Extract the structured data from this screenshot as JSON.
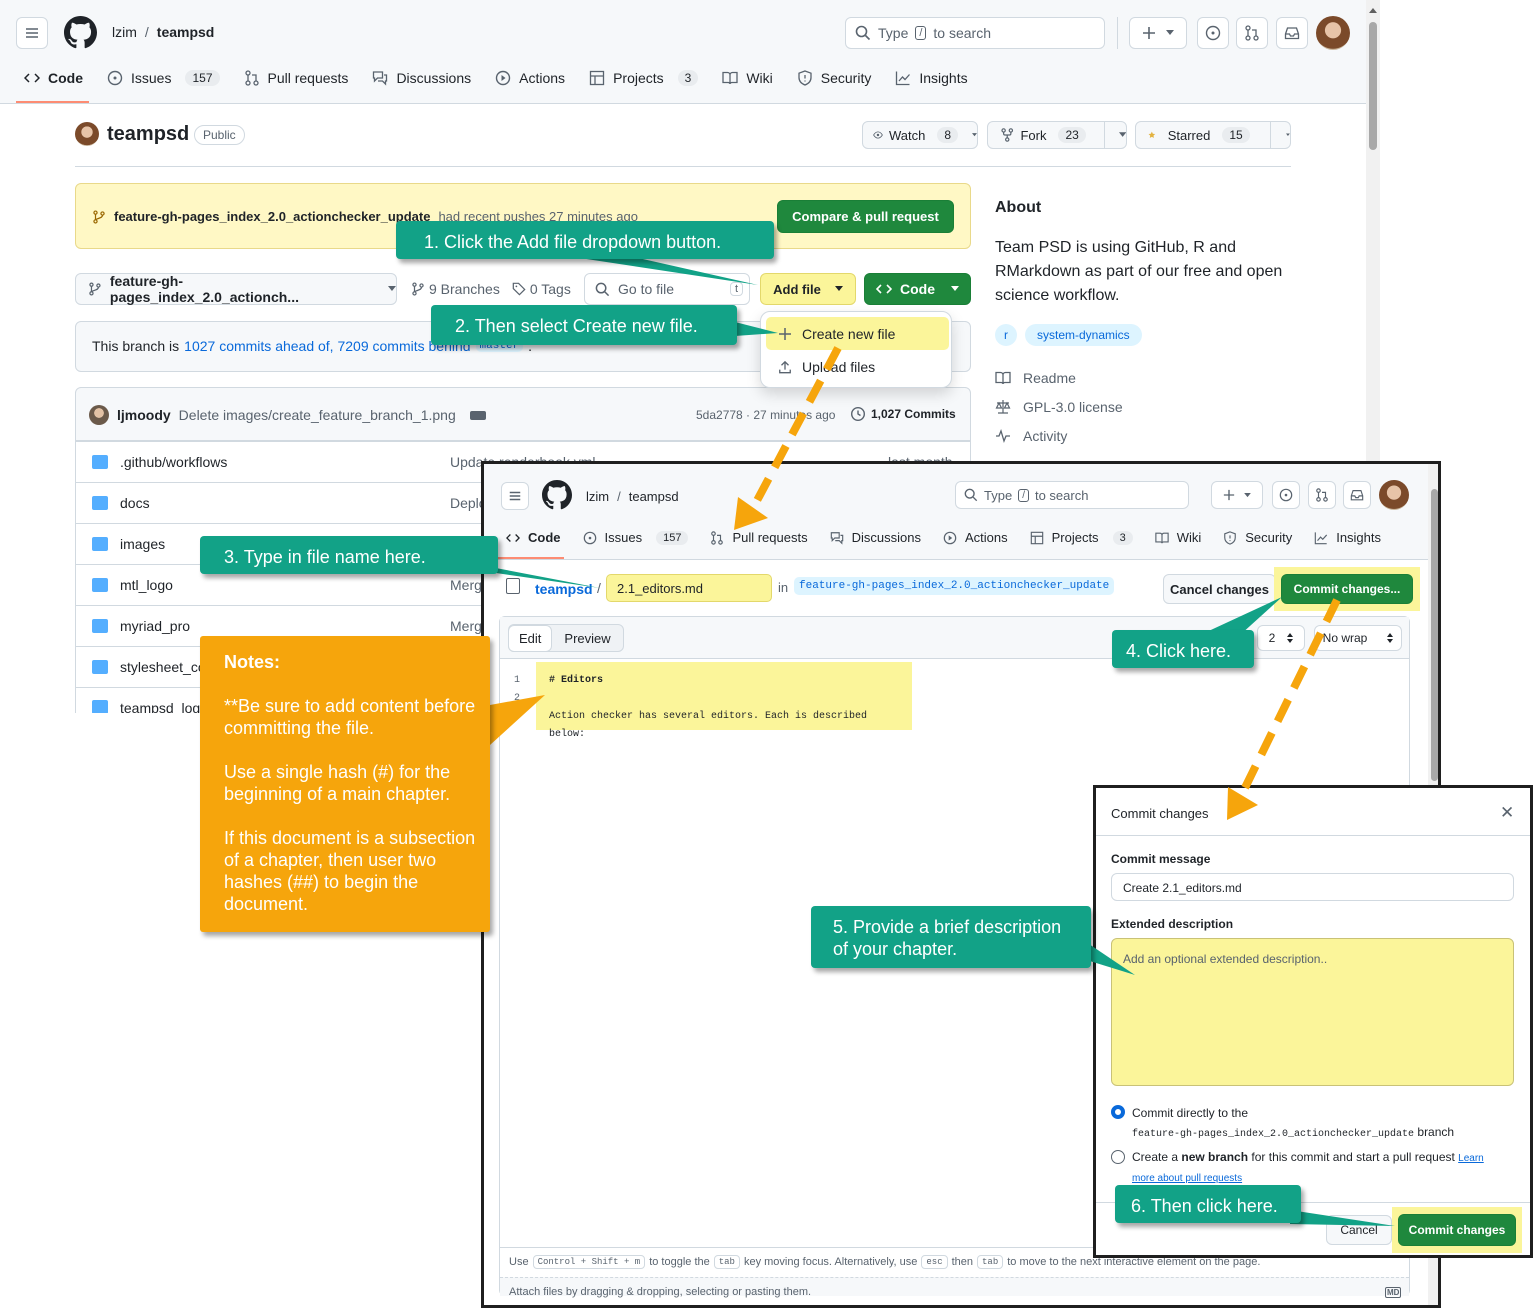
{
  "top": {
    "owner": "lzim",
    "repo": "teampsd",
    "search_prefix": "Type",
    "search_key": "/",
    "search_suffix": "to search"
  },
  "tabs": [
    {
      "label": "Code",
      "count": ""
    },
    {
      "label": "Issues",
      "count": "157"
    },
    {
      "label": "Pull requests",
      "count": ""
    },
    {
      "label": "Discussions",
      "count": ""
    },
    {
      "label": "Actions",
      "count": ""
    },
    {
      "label": "Projects",
      "count": "3"
    },
    {
      "label": "Wiki",
      "count": ""
    },
    {
      "label": "Security",
      "count": ""
    },
    {
      "label": "Insights",
      "count": ""
    }
  ],
  "repo_header": {
    "name": "teampsd",
    "visibility": "Public",
    "watch_label": "Watch",
    "watch_count": "8",
    "fork_label": "Fork",
    "fork_count": "23",
    "star_label": "Starred",
    "star_count": "15"
  },
  "banner": {
    "branch": "feature-gh-pages_index_2.0_actionchecker_update",
    "text": "had recent pushes 27 minutes ago",
    "button": "Compare & pull request"
  },
  "toolbar": {
    "branch": "feature-gh-pages_index_2.0_actionch...",
    "branches": "9 Branches",
    "tags": "0 Tags",
    "goto_placeholder": "Go to file",
    "goto_key": "t",
    "add_file": "Add file",
    "code": "Code"
  },
  "dropdown": {
    "create": "Create new file",
    "upload": "Upload files"
  },
  "ahead": {
    "prefix": "This branch is",
    "link": "1027 commits ahead of, 7209 commits behind",
    "base": "master",
    "suffix": "."
  },
  "commit": {
    "author": "ljmoody",
    "message": "Delete images/create_feature_branch_1.png",
    "meta": "5da2778 · 27 minutes ago",
    "count": "1,027 Commits"
  },
  "files": [
    {
      "name": ".github/workflows",
      "msg": "Update renderbook.yml",
      "time": "last month"
    },
    {
      "name": "docs",
      "msg": "Deplo",
      "time": ""
    },
    {
      "name": "images",
      "msg": "",
      "time": ""
    },
    {
      "name": "mtl_logo",
      "msg": "Merg",
      "time": ""
    },
    {
      "name": "myriad_pro",
      "msg": "Merg",
      "time": ""
    },
    {
      "name": "stylesheet_co",
      "msg": "",
      "time": ""
    },
    {
      "name": "teampsd_logo",
      "msg": "",
      "time": ""
    }
  ],
  "about": {
    "title": "About",
    "description": "Team PSD is using GitHub, R and RMarkdown as part of our free and open science workflow.",
    "topics": [
      "r",
      "system-dynamics"
    ],
    "links": [
      "Readme",
      "GPL-3.0 license",
      "Activity"
    ]
  },
  "editor": {
    "repo_link": "teampsd",
    "filename": "2.1_editors.md",
    "in": "in",
    "branch": "feature-gh-pages_index_2.0_actionchecker_update",
    "cancel": "Cancel changes",
    "commit": "Commit changes...",
    "edit_tab": "Edit",
    "preview_tab": "Preview",
    "indent_value": "2",
    "wrap_value": "No wrap",
    "lines": [
      {
        "num": "1",
        "text": "# Editors"
      },
      {
        "num": "2",
        "text": ""
      },
      {
        "num": "",
        "text": "Action checker has several editors. Each is described below:"
      }
    ],
    "footer_1": "Use",
    "key_1": "Control + Shift + m",
    "footer_2": "to toggle the",
    "key_2": "tab",
    "footer_3": "key moving focus. Alternatively, use",
    "key_3": "esc",
    "footer_4": "then",
    "key_4": "tab",
    "footer_5": "to move to the next interactive element on the page.",
    "attach": "Attach files by dragging & dropping, selecting or pasting them.",
    "md_badge": "MD"
  },
  "dialog": {
    "title": "Commit changes",
    "message_label": "Commit message",
    "message_value": "Create 2.1_editors.md",
    "desc_label": "Extended description",
    "desc_placeholder": "Add an optional extended description..",
    "opt1_text": "Commit directly to the",
    "opt1_branch": "feature-gh-pages_index_2.0_actionchecker_update",
    "opt1_suffix": "branch",
    "opt2_a": "Create a",
    "opt2_b": "new branch",
    "opt2_c": "for this commit and start a pull request",
    "opt2_link1": "Learn",
    "opt2_link2": "more about pull requests",
    "cancel": "Cancel",
    "commit": "Commit changes"
  },
  "callouts": {
    "c1": "1. Click the Add file dropdown button.",
    "c2": "2. Then select Create new file.",
    "c3": "3. Type in file name here.",
    "c4": "4. Click here.",
    "c5": "5. Provide a brief description of your chapter.",
    "c6": "6. Then click here."
  },
  "notes": {
    "title": "Notes:",
    "p1": "**Be sure to add content before committing the file.",
    "p2": "Use a single hash (#) for the beginning of a main chapter.",
    "p3": "If this document is a subsection of a chapter, then user two hashes (##) to begin the document."
  },
  "colors": {
    "accent_green": "#1f883d",
    "callout": "#12a287",
    "notes": "#f6a50c",
    "highlight": "#fbf59a",
    "arrow": "#f6a50c"
  }
}
